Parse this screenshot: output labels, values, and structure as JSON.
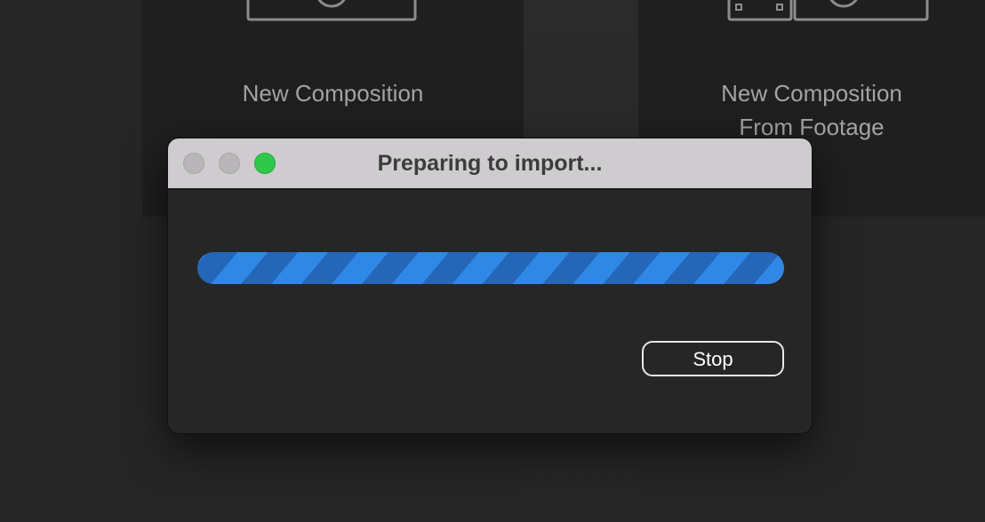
{
  "cards": {
    "new_composition": {
      "label": "New Composition",
      "icon": "composition-icon"
    },
    "new_composition_from_footage": {
      "label_line1": "New Composition",
      "label_line2": "From Footage",
      "icon": "footage-composition-icon"
    }
  },
  "dialog": {
    "title": "Preparing to import...",
    "window_controls": [
      "close",
      "minimize",
      "zoom"
    ],
    "progress": {
      "state": "indeterminate",
      "color": "#2f88e6",
      "stripe_color": "#2466b8"
    },
    "stop_label": "Stop"
  },
  "colors": {
    "background": "#262626",
    "card": "#1f1f1f",
    "titlebar": "#cfcccf",
    "zoom_button": "#2ec84a"
  }
}
